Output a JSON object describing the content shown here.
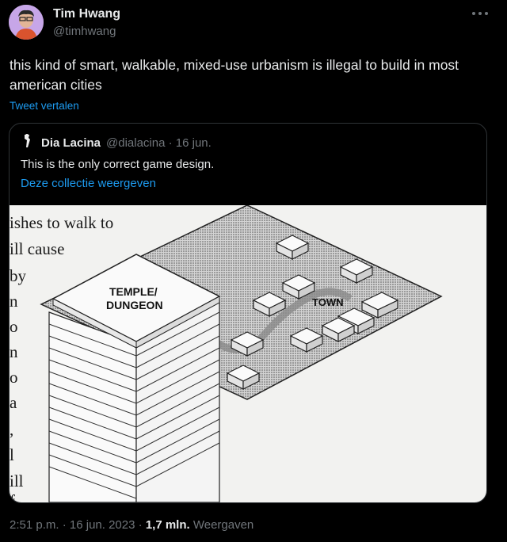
{
  "tweet": {
    "author_name": "Tim Hwang",
    "author_handle": "@timhwang",
    "text": "this kind of smart, walkable, mixed-use urbanism is illegal to build in most american cities",
    "translate_label": "Tweet vertalen",
    "more_icon": "more-icon"
  },
  "quote": {
    "author_name": "Dia Lacina",
    "author_handle": "@dialacina",
    "separator": "·",
    "date": "16 jun.",
    "text": "This is the only correct game design.",
    "collection_link": "Deze collectie weergeven",
    "image": {
      "book_text_lines": [
        "ishes to walk to",
        "ill cause",
        "by",
        "n",
        "o",
        "n",
        "o",
        "a",
        ",",
        "l",
        "ill",
        "f"
      ],
      "temple_label": "TEMPLE/",
      "dungeon_label": "DUNGEON",
      "town_label": "TOWN"
    }
  },
  "footer": {
    "time": "2:51 p.m.",
    "dot": "·",
    "date": "16 jun. 2023",
    "dot2": "·",
    "views_count": "1,7 mln.",
    "views_label": "Weergaven"
  },
  "colors": {
    "background": "#000000",
    "text": "#e7e9ea",
    "secondary": "#71767b",
    "link": "#1d9bf0",
    "border": "#2f3336"
  }
}
